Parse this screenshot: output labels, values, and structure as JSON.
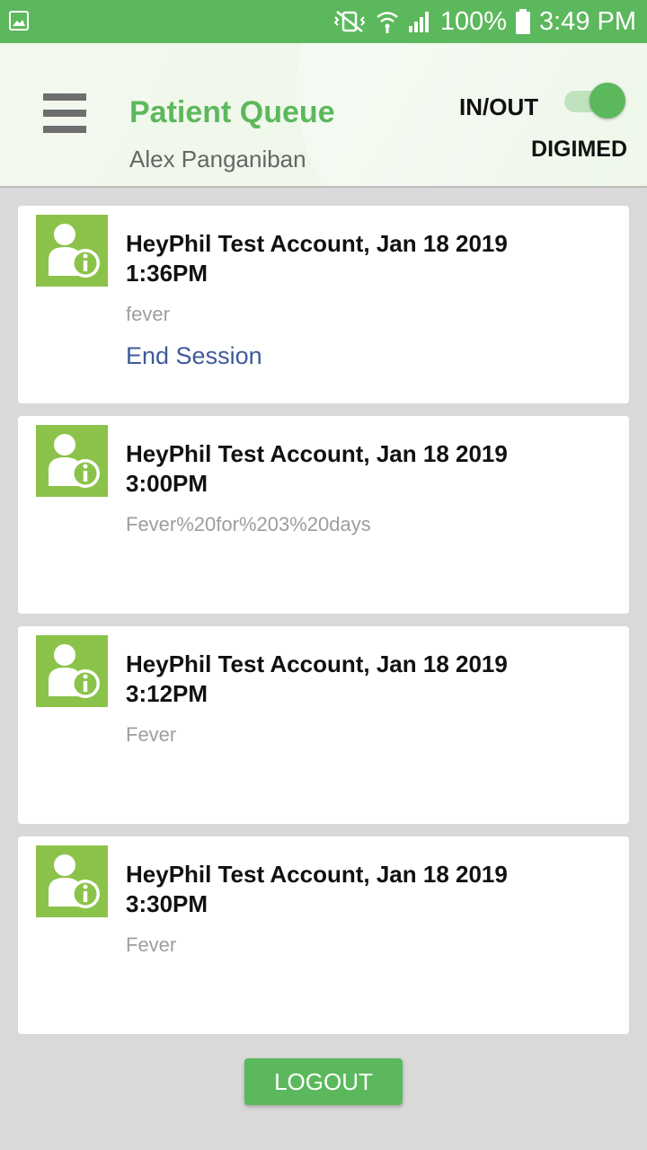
{
  "status_bar": {
    "battery": "100%",
    "time": "3:49 PM",
    "icons": [
      "gallery-icon",
      "vibrate-mute-icon",
      "wifi-icon",
      "signal-icon",
      "battery-icon"
    ]
  },
  "header": {
    "title": "Patient Queue",
    "user_name": "Alex Panganiban",
    "toggle_label": "IN/OUT",
    "toggle_on": true,
    "brand": "DIGIMED"
  },
  "queue": [
    {
      "name_line1": "HeyPhil Test Account, Jan 18 2019",
      "name_line2": "1:36PM",
      "complaint": "fever",
      "action": "End Session"
    },
    {
      "name_line1": "HeyPhil Test Account, Jan 18 2019",
      "name_line2": "3:00PM",
      "complaint": "Fever%20for%203%20days"
    },
    {
      "name_line1": "HeyPhil Test Account, Jan 18 2019",
      "name_line2": "3:12PM",
      "complaint": "Fever"
    },
    {
      "name_line1": "HeyPhil Test Account, Jan 18 2019",
      "name_line2": "3:30PM",
      "complaint": "Fever"
    }
  ],
  "logout_label": "LOGOUT",
  "colors": {
    "accent": "#5cb85c",
    "avatar_bg": "#8bc34a",
    "link": "#3d5a99"
  }
}
